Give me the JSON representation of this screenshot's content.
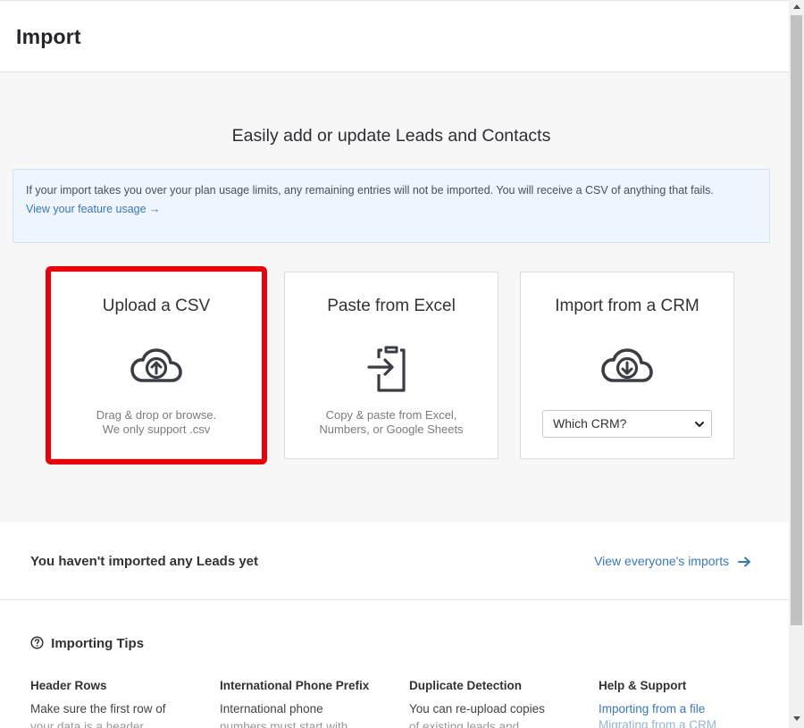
{
  "header": {
    "title": "Import"
  },
  "hero": {
    "title": "Easily add or update Leads and Contacts",
    "notice": {
      "text": "If your import takes you over your plan usage limits, any remaining entries will not be imported. You will receive a CSV of anything that fails.",
      "link": "View your feature usage →"
    }
  },
  "cards": {
    "csv": {
      "title": "Upload a CSV",
      "icon": "cloud-upload-icon",
      "line1": "Drag & drop or browse.",
      "line2": "We only support .csv"
    },
    "excel": {
      "title": "Paste from Excel",
      "icon": "clipboard-import-icon",
      "line1": "Copy & paste from Excel,",
      "line2": "Numbers, or Google Sheets"
    },
    "crm": {
      "title": "Import from a CRM",
      "icon": "cloud-download-icon",
      "select_value": "Which CRM?"
    }
  },
  "status": {
    "text": "You haven't imported any Leads yet",
    "link": "View everyone's imports"
  },
  "tips": {
    "title": "Importing Tips",
    "columns": [
      {
        "heading": "Header Rows",
        "body": "Make sure the first row of",
        "cut": "your data is a header"
      },
      {
        "heading": "International Phone Prefix",
        "body": "International phone",
        "cut": "numbers must start with"
      },
      {
        "heading": "Duplicate Detection",
        "body": "You can re-upload copies",
        "cut": "of existing leads and"
      },
      {
        "heading": "Help & Support",
        "link1": "Importing from a file",
        "link2": "Migrating from a CRM"
      }
    ]
  },
  "colors": {
    "accent": "#3a78b3",
    "highlight": "#e8000b",
    "notice_bg": "#eef5fc"
  }
}
